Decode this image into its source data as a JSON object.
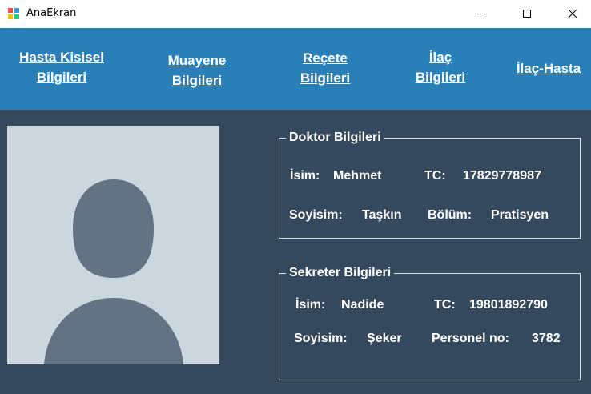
{
  "window": {
    "title": "AnaEkran"
  },
  "nav": {
    "hasta": "Hasta Kisisel\nBilgileri",
    "muayene": "Muayene\nBilgileri",
    "recete": "Reçete\nBilgileri",
    "ilac": "İlaç\nBilgileri",
    "ilac_hasta": "İlaç-Hasta"
  },
  "doktor": {
    "title": "Doktor Bilgileri",
    "isim_label": "İsim:",
    "isim": "Mehmet",
    "tc_label": "TC:",
    "tc": "17829778987",
    "soyisim_label": "Soyisim:",
    "soyisim": "Taşkın",
    "bolum_label": "Bölüm:",
    "bolum": "Pratisyen"
  },
  "sekreter": {
    "title": "Sekreter Bilgileri",
    "isim_label": "İsim:",
    "isim": "Nadide",
    "tc_label": "TC:",
    "tc": "19801892790",
    "soyisim_label": "Soyisim:",
    "soyisim": "Şeker",
    "personel_label": "Personel no:",
    "personel": "3782"
  },
  "colors": {
    "background": "#34495e",
    "navbar": "#2980b9",
    "photo_bg": "#cbd6de",
    "avatar": "#637384"
  },
  "icons": {
    "app": "app-icon",
    "minimize": "minimize-icon",
    "maximize": "maximize-icon",
    "close": "close-icon",
    "avatar": "user-silhouette-icon"
  }
}
